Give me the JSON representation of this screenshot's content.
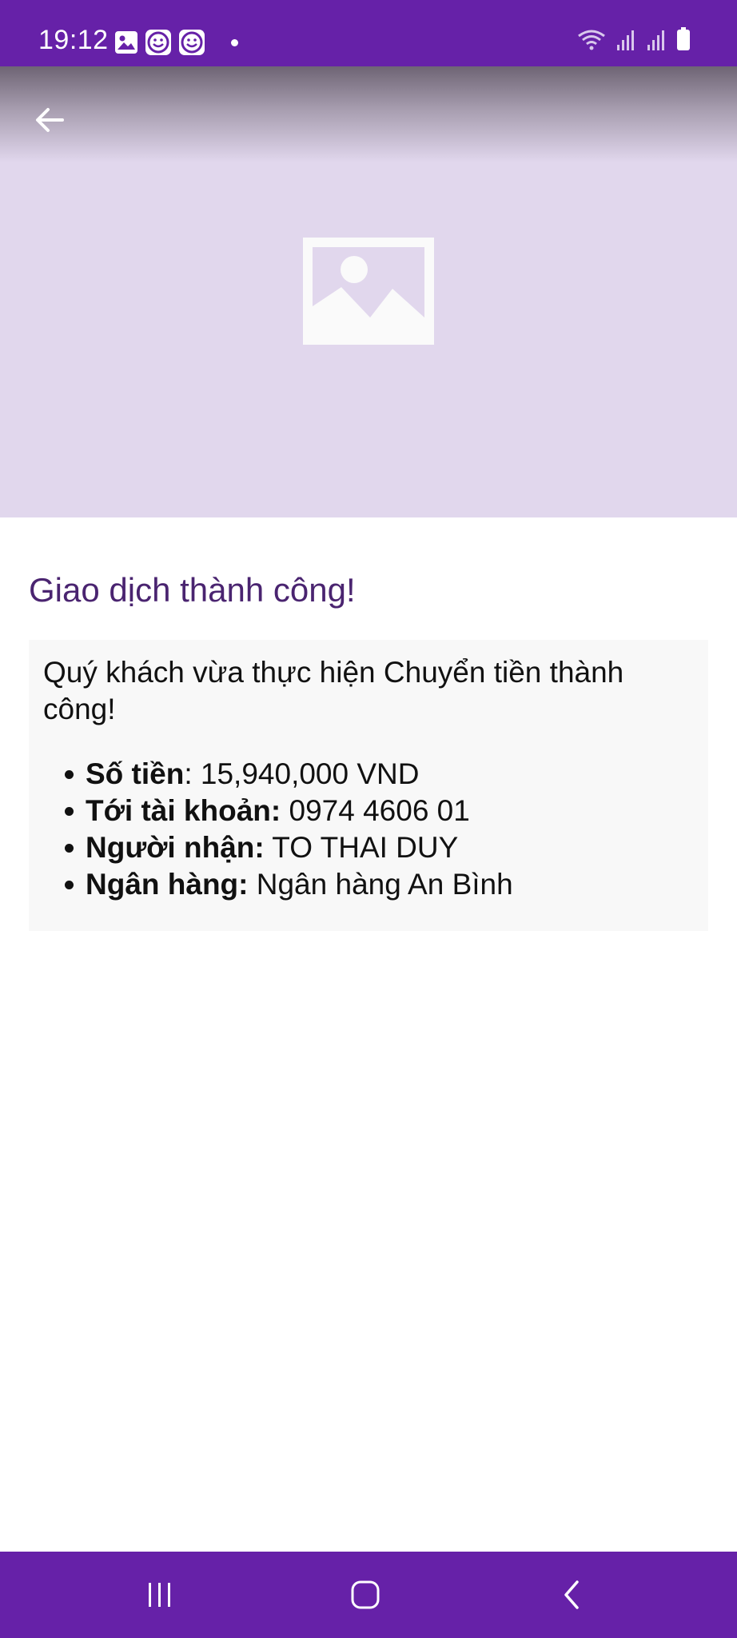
{
  "status_bar": {
    "time": "19:12",
    "left_icons": [
      "gallery-icon",
      "smiley-icon",
      "smiley-icon"
    ],
    "right_icons": [
      "wifi-icon",
      "signal-icon",
      "signal-icon",
      "battery-icon"
    ]
  },
  "colors": {
    "accent": "#6621a8",
    "title": "#4a2470",
    "hero_bg": "#e1d7ed",
    "panel_bg": "#f8f8f8"
  },
  "page": {
    "title": "Giao dịch thành công!",
    "message": "Quý khách vừa thực hiện Chuyển tiền thành công!",
    "details": [
      {
        "label": "Số tiền",
        "value": ": 15,940,000 VND"
      },
      {
        "label": "Tới tài khoản:",
        "value": " 0974 4606 01"
      },
      {
        "label": "Người nhận:",
        "value": " TO THAI DUY"
      },
      {
        "label": "Ngân hàng:",
        "value": " Ngân hàng An Bình"
      }
    ]
  },
  "nav_bar": {
    "buttons": [
      "recents-icon",
      "home-icon",
      "back-icon"
    ]
  }
}
